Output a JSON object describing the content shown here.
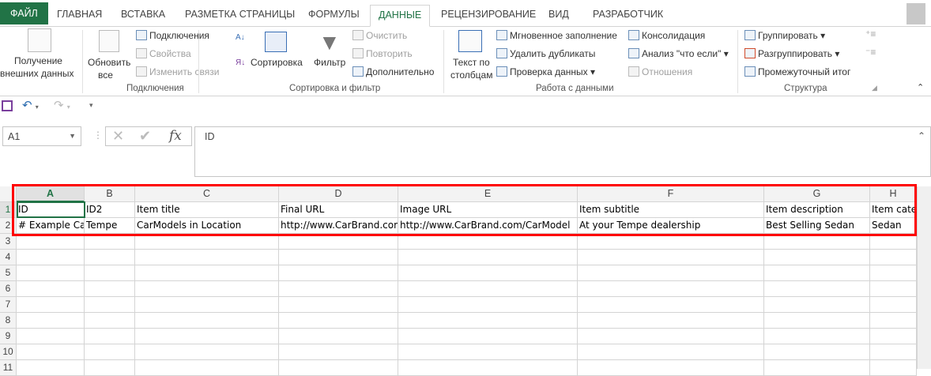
{
  "tabs": [
    "ФАЙЛ",
    "ГЛАВНАЯ",
    "ВСТАВКА",
    "РАЗМЕТКА СТРАНИЦЫ",
    "ФОРМУЛЫ",
    "ДАННЫЕ",
    "РЕЦЕНЗИРОВАНИЕ",
    "ВИД",
    "РАЗРАБОТЧИК"
  ],
  "ribbon": {
    "get_external_1": "Получение",
    "get_external_2": "внешних данных",
    "refresh_1": "Обновить",
    "refresh_2": "все",
    "connections": "Подключения",
    "properties": "Свойства",
    "edit_links": "Изменить связи",
    "group_connections": "Подключения",
    "sort": "Сортировка",
    "filter": "Фильтр",
    "clear": "Очистить",
    "reapply": "Повторить",
    "advanced": "Дополнительно",
    "group_sort": "Сортировка и фильтр",
    "text_to_cols_1": "Текст по",
    "text_to_cols_2": "столбцам",
    "flash_fill": "Мгновенное заполнение",
    "remove_dup": "Удалить дубликаты",
    "validation": "Проверка данных",
    "consolidate": "Консолидация",
    "whatif": "Анализ \"что если\"",
    "relations": "Отношения",
    "group_data": "Работа с данными",
    "group": "Группировать",
    "ungroup": "Разгруппировать",
    "subtotal": "Промежуточный итог",
    "group_outline": "Структура"
  },
  "name_box": "A1",
  "formula": "ID",
  "fx": "fx",
  "columns": [
    "A",
    "B",
    "C",
    "D",
    "E",
    "F",
    "G",
    "H"
  ],
  "rows": [
    [
      "ID",
      "ID2",
      "Item title",
      "Final URL",
      "Image URL",
      "Item subtitle",
      "Item description",
      "Item category"
    ],
    [
      "# Example Car",
      "Tempe",
      "CarModels in Location",
      "http://www.CarBrand.com",
      "http://www.CarBrand.com/CarModel",
      "At your Tempe dealership",
      "Best Selling Sedan",
      "Sedan"
    ]
  ],
  "row_count": 11
}
